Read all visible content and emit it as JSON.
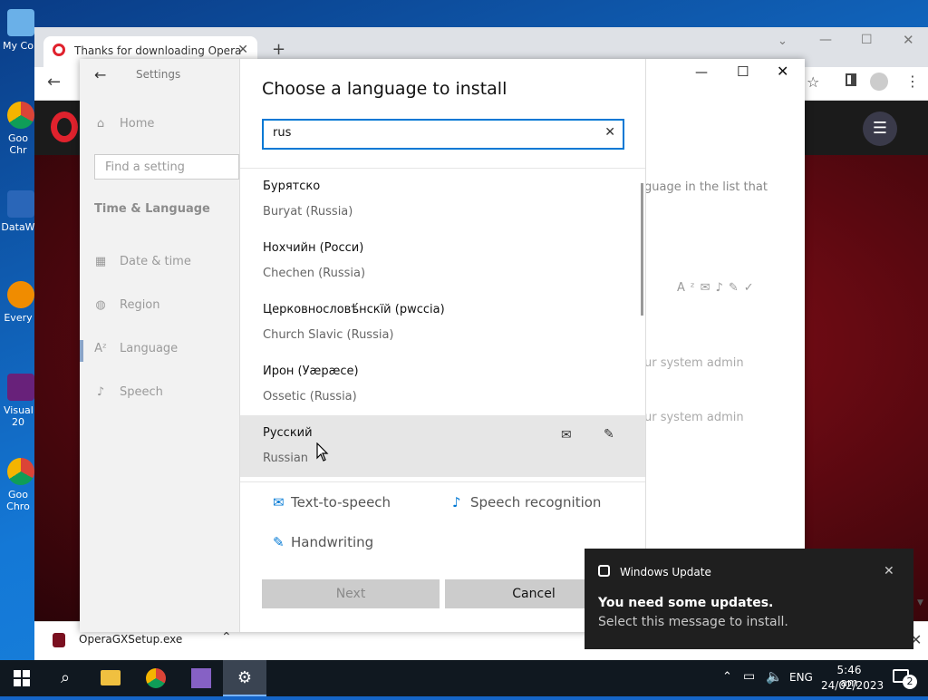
{
  "desktop": {
    "icons": [
      {
        "label": "My Co",
        "icon": "computer-icon"
      },
      {
        "label": "Goo Chr",
        "icon": "chrome-icon"
      },
      {
        "label": "DataW",
        "icon": "datawrapper-icon"
      },
      {
        "label": "Every",
        "icon": "everything-icon"
      },
      {
        "label": "Visual 20",
        "icon": "visual-studio-icon"
      },
      {
        "label": "Goo Chro",
        "icon": "chrome-icon"
      }
    ]
  },
  "browser": {
    "tab_title": "Thanks for downloading Opera",
    "download_file": "OperaGXSetup.exe"
  },
  "settings": {
    "header": "Settings",
    "home": "Home",
    "search_placeholder": "Find a setting",
    "section": "Time & Language",
    "nav": [
      {
        "label": "Date & time",
        "icon": "calendar-icon"
      },
      {
        "label": "Region",
        "icon": "globe-icon"
      },
      {
        "label": "Language",
        "icon": "language-icon"
      },
      {
        "label": "Speech",
        "icon": "microphone-icon"
      }
    ],
    "bg_text_1": "guage in the list that",
    "bg_text_2": "ur system admin",
    "bg_text_3": "ur system admin"
  },
  "dialog": {
    "title": "Choose a language to install",
    "search_value": "rus",
    "languages": [
      {
        "native": "Бурятско",
        "english": "Buryat (Russia)"
      },
      {
        "native": "Нохчийн (Росси)",
        "english": "Chechen (Russia)"
      },
      {
        "native": "Церковнословѣ́нскїй (рwссіа)",
        "english": "Church Slavic (Russia)"
      },
      {
        "native": "Ирон (Уæрæсе)",
        "english": "Ossetic (Russia)"
      },
      {
        "native": "Русский",
        "english": "Russian"
      }
    ],
    "legend": {
      "tts": "Text-to-speech",
      "speech": "Speech recognition",
      "handwriting": "Handwriting"
    },
    "next": "Next",
    "cancel": "Cancel"
  },
  "toast": {
    "app": "Windows Update",
    "title": "You need some updates.",
    "body": "Select this message to install."
  },
  "taskbar": {
    "lang": "ENG",
    "time": "5:46 am",
    "date": "24/02/2023",
    "notifications": "2"
  }
}
